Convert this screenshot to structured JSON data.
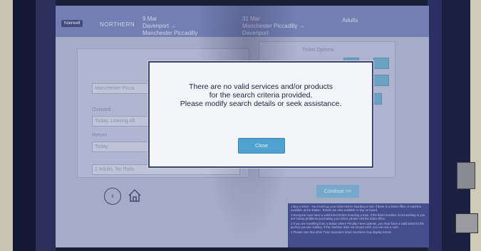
{
  "kiosk": {
    "screen": {
      "header": {
        "logo": "hoerwell",
        "brand": "NORTHERN",
        "outbound": {
          "date": "9 Mar",
          "route": "Davenport →",
          "destination": "Manchester Piccadilly"
        },
        "return": {
          "date": "31 Mar",
          "route": "Manchester Piccadilly →",
          "destination": "Davenport"
        },
        "tickets_label": "Adults"
      },
      "form": {
        "to_field": "Manchester Picca",
        "outward_label": "Outward",
        "outward_value": "Today, Leaving Aft",
        "return_label": "Return",
        "return_value": "Today",
        "passengers_value": "2 Adults, No Rails"
      },
      "right_panel": {
        "title": "Ticket Options",
        "continue_label": "Continue >>"
      },
      "terms": [
        "1 Buy a ticket - You must buy your ticket before boarding a train if there is a ticket office or machine available at the station. Tickets are also available to buy on board.",
        "2 Everyone must have a valid ticket before boarding a train. If the ticket machine is not working or you are having problems purchasing your ticket, please visit the ticket office.",
        "3 If you are travelling from a station where Penalty Fares operate, you must have a valid ticket for the journey you are making. If the machine does not accept cash, you can use a card.",
        "4 Please note that other Train Operators ticket machines may display tickets"
      ],
      "dialog": {
        "line1": "There are no valid services and/or products",
        "line2": "for the search criteria provided.",
        "line3": "Please modify search details or seek assistance.",
        "close_label": "Close"
      },
      "nav": {
        "back_icon": "back-arrow-icon",
        "home_icon": "home-icon"
      }
    },
    "colors": {
      "dialog_button": "#4fa2cf",
      "header": "#6d77b3",
      "bezel": "#1b1f42"
    }
  }
}
